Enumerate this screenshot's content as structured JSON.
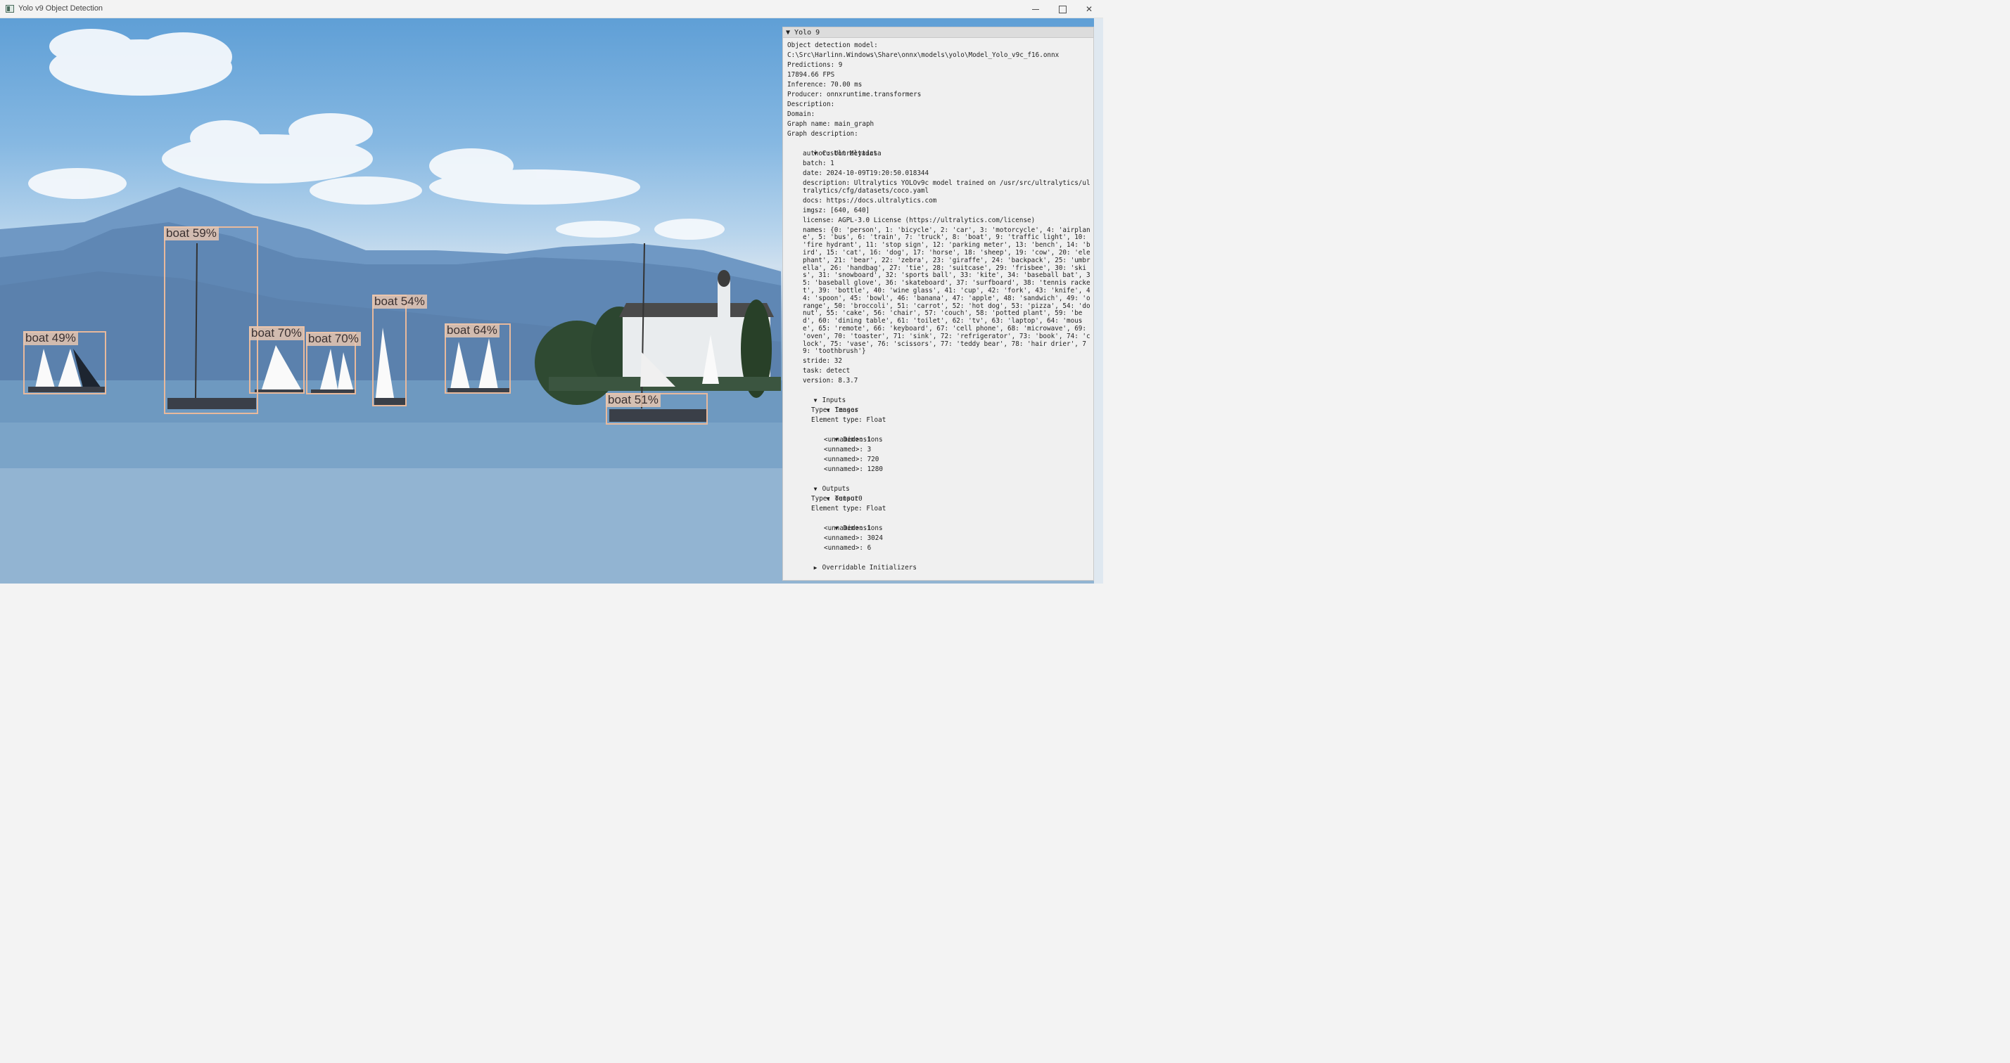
{
  "window": {
    "title": "Yolo v9 Object Detection"
  },
  "detections": [
    {
      "label": "boat 49%"
    },
    {
      "label": "boat 59%"
    },
    {
      "label": "boat 70%"
    },
    {
      "label": "boat 70%"
    },
    {
      "label": "boat 54%"
    },
    {
      "label": "boat 64%"
    },
    {
      "label": "boat 51%"
    }
  ],
  "panel": {
    "title": "Yolo 9",
    "model_label": "Object detection model:",
    "model_path": "C:\\Src\\Harlinn.Windows\\Share\\onnx\\models\\yolo\\Model_Yolo_v9c_f16.onnx",
    "predictions": "Predictions: 9",
    "fps": "17894.66 FPS",
    "inference": "Inference: 70.00 ms",
    "producer": "Producer: onnxruntime.transformers",
    "description": "Description:",
    "domain": "Domain:",
    "graph_name": "Graph name: main_graph",
    "graph_description": "Graph description:",
    "custom_metadata": {
      "label": "Custom Metadata",
      "author": "author: Ultralytics",
      "batch": "batch: 1",
      "date": "date: 2024-10-09T19:20:50.018344",
      "description": "description: Ultralytics YOLOv9c model trained on /usr/src/ultralytics/ultralytics/cfg/datasets/coco.yaml",
      "docs": "docs: https://docs.ultralytics.com",
      "imgsz": "imgsz: [640, 640]",
      "license": "license: AGPL-3.0 License (https://ultralytics.com/license)",
      "names": "names: {0: 'person', 1: 'bicycle', 2: 'car', 3: 'motorcycle', 4: 'airplane', 5: 'bus', 6: 'train', 7: 'truck', 8: 'boat', 9: 'traffic light', 10: 'fire hydrant', 11: 'stop sign', 12: 'parking meter', 13: 'bench', 14: 'bird', 15: 'cat', 16: 'dog', 17: 'horse', 18: 'sheep', 19: 'cow', 20: 'elephant', 21: 'bear', 22: 'zebra', 23: 'giraffe', 24: 'backpack', 25: 'umbrella', 26: 'handbag', 27: 'tie', 28: 'suitcase', 29: 'frisbee', 30: 'skis', 31: 'snowboard', 32: 'sports ball', 33: 'kite', 34: 'baseball bat', 35: 'baseball glove', 36: 'skateboard', 37: 'surfboard', 38: 'tennis racket', 39: 'bottle', 40: 'wine glass', 41: 'cup', 42: 'fork', 43: 'knife', 44: 'spoon', 45: 'bowl', 46: 'banana', 47: 'apple', 48: 'sandwich', 49: 'orange', 50: 'broccoli', 51: 'carrot', 52: 'hot dog', 53: 'pizza', 54: 'donut', 55: 'cake', 56: 'chair', 57: 'couch', 58: 'potted plant', 59: 'bed', 60: 'dining table', 61: 'toilet', 62: 'tv', 63: 'laptop', 64: 'mouse', 65: 'remote', 66: 'keyboard', 67: 'cell phone', 68: 'microwave', 69: 'oven', 70: 'toaster', 71: 'sink', 72: 'refrigerator', 73: 'book', 74: 'clock', 75: 'vase', 76: 'scissors', 77: 'teddy bear', 78: 'hair drier', 79: 'toothbrush'}",
      "stride": "stride: 32",
      "task": "task: detect",
      "version": "version: 8.3.7"
    },
    "inputs": {
      "label": "Inputs",
      "name": "images",
      "type": "Type: Tensor",
      "element_type": "Element type: Float",
      "dimensions_label": "Dimensions",
      "dims": [
        "<unnamed>: 1",
        "<unnamed>: 3",
        "<unnamed>: 720",
        "<unnamed>: 1280"
      ]
    },
    "outputs": {
      "label": "Outputs",
      "name": "output0",
      "type": "Type: Tensor",
      "element_type": "Element type: Float",
      "dimensions_label": "Dimensions",
      "dims": [
        "<unnamed>: 1",
        "<unnamed>: 3024",
        "<unnamed>: 6"
      ]
    },
    "overridable_initializers": "Overridable Initializers"
  }
}
